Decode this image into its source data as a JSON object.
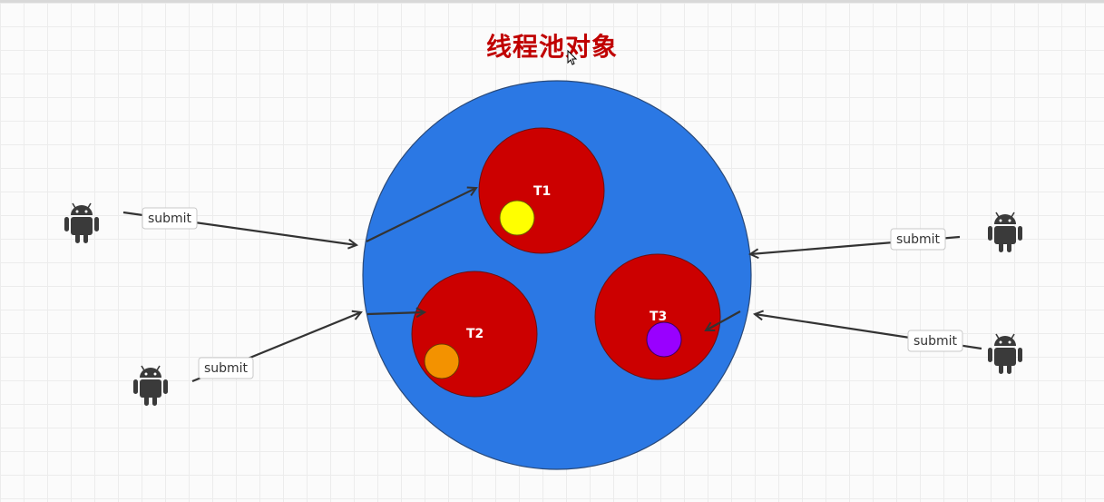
{
  "title": "线程池对象",
  "threads": [
    {
      "label": "T1"
    },
    {
      "label": "T2"
    },
    {
      "label": "T3"
    }
  ],
  "edge_labels": {
    "left_top": "submit",
    "left_bottom": "submit",
    "right_top": "submit",
    "right_bottom": "submit"
  },
  "colors": {
    "title": "#c00000",
    "pool": "#2b78e4",
    "thread": "#cc0000",
    "task_t1": "#ffff00",
    "task_t2": "#f39200",
    "task_t3": "#9900ff",
    "arrow": "#333333"
  },
  "icons": {
    "client": "android-icon"
  }
}
